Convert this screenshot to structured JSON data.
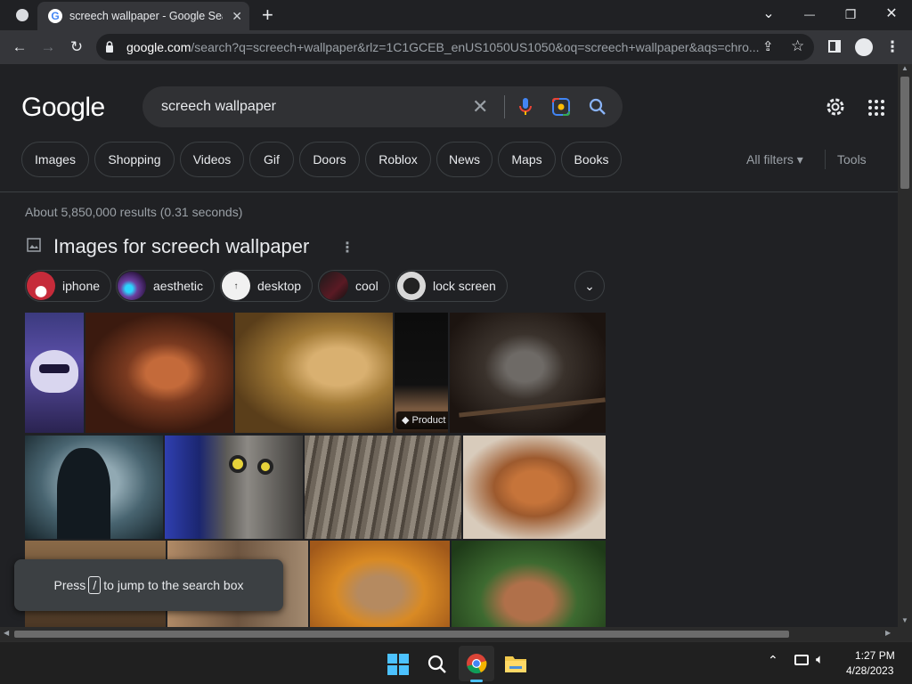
{
  "browser": {
    "tab_title": "screech wallpaper - Google Search",
    "tab_close": "✕",
    "new_tab": "+",
    "window_controls": {
      "dropdown": "⌄",
      "minimize": "—",
      "restore": "❐",
      "close": "✕"
    },
    "url_host": "google.com",
    "url_path": "/search?q=screech+wallpaper&rlz=1C1GCEB_enUS1050US1050&oq=screech+wallpaper&aqs=chro..."
  },
  "google": {
    "logo": "Google",
    "query": "screech wallpaper",
    "clear_icon": "✕",
    "filter_chips": [
      "Images",
      "Shopping",
      "Videos",
      "Gif",
      "Doors",
      "Roblox",
      "News",
      "Maps",
      "Books"
    ],
    "all_filters": "All filters ▾",
    "tools": "Tools",
    "result_stats": "About 5,850,000 results (0.31 seconds)",
    "images_header": "Images for screech wallpaper",
    "related_chips": [
      {
        "label": "iphone",
        "color": "#c62b3a"
      },
      {
        "label": "aesthetic",
        "color": "#6b3fa0"
      },
      {
        "label": "desktop",
        "color": "#f1f1f1"
      },
      {
        "label": "cool",
        "color": "#5a1a24"
      },
      {
        "label": "lock screen",
        "color": "#d8d8d8"
      }
    ],
    "product_badge": "Product",
    "toast_press": "Press",
    "toast_key": "/",
    "toast_rest": "to jump to the search box"
  },
  "taskbar": {
    "time": "1:27 PM",
    "date": "4/28/2023"
  },
  "colors": {
    "accent_blue": "#8ab4f8",
    "background": "#202124"
  }
}
